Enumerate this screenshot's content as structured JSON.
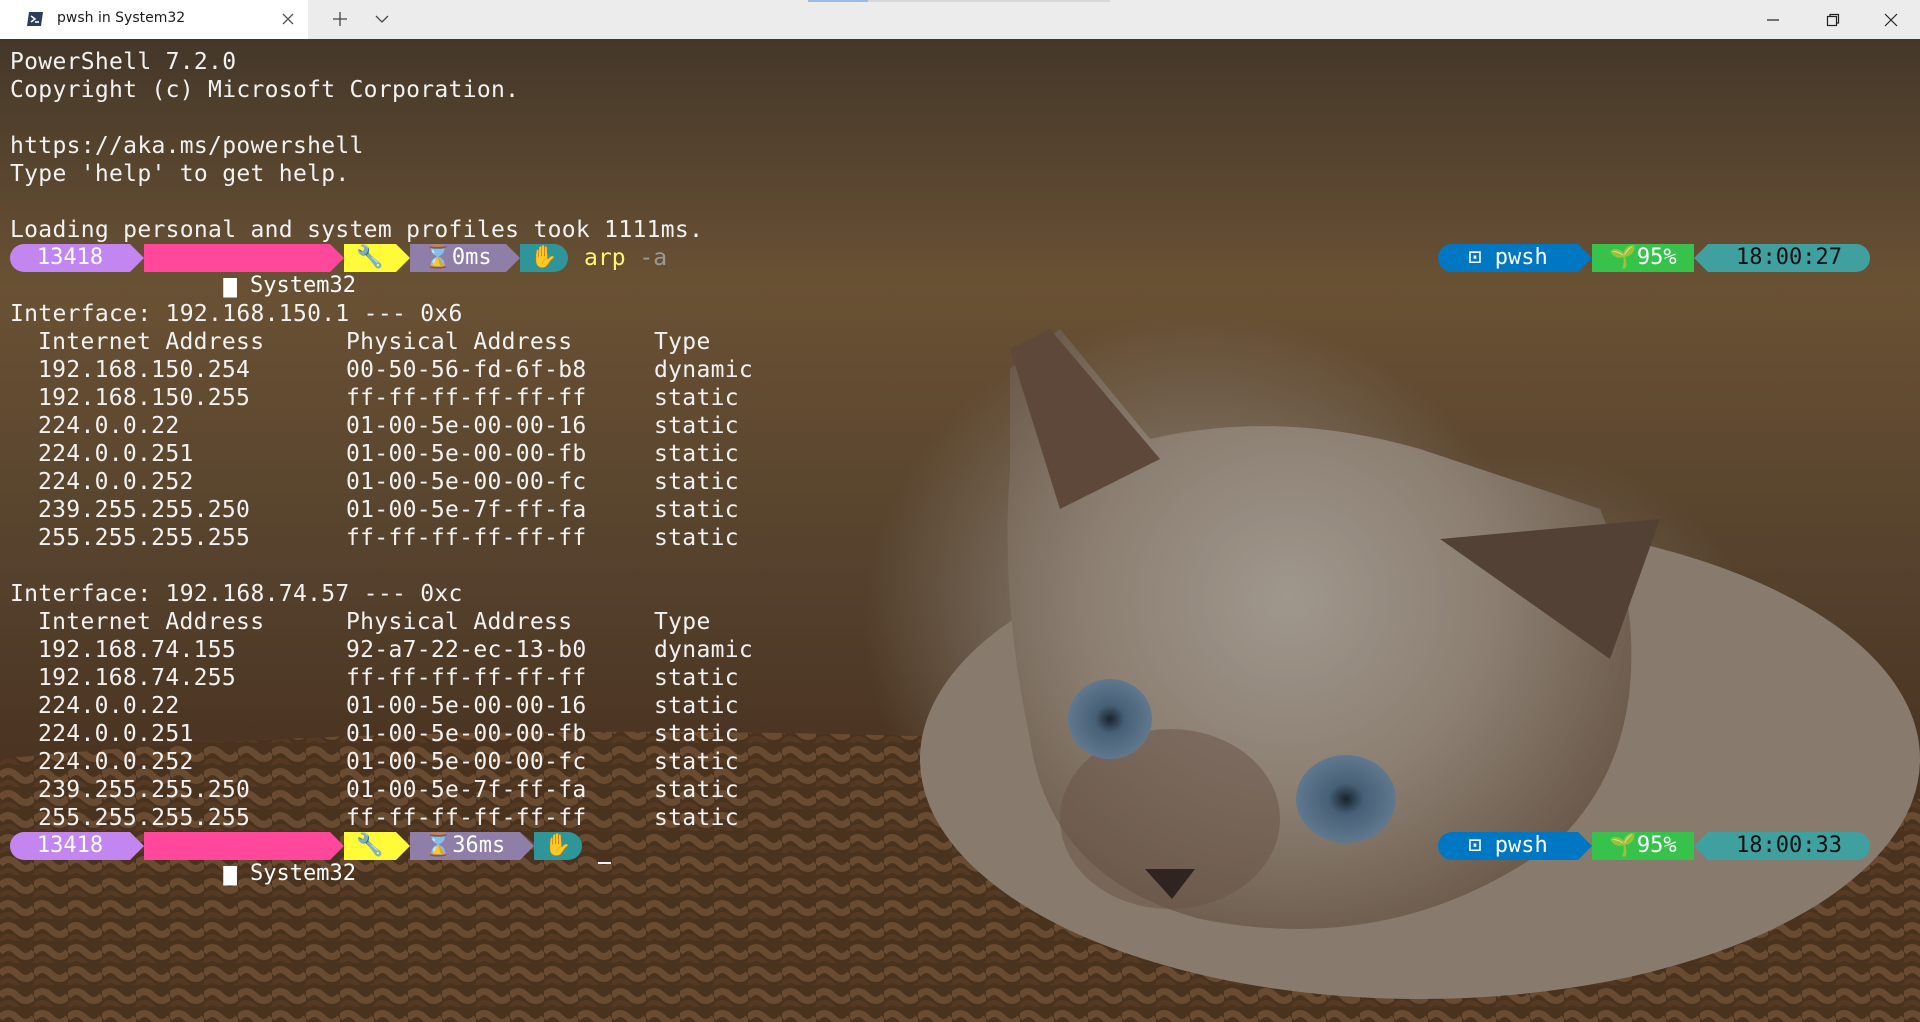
{
  "window": {
    "tab_title": "pwsh in System32",
    "tab_icon": "powershell-icon",
    "new_tab_icon": "plus-icon",
    "dropdown_icon": "chevron-down-icon",
    "controls": [
      "minimize-icon",
      "maximize-icon",
      "close-icon"
    ]
  },
  "banner": {
    "version": "PowerShell 7.2.0",
    "copyright": "Copyright (c) Microsoft Corporation.",
    "url": "https://aka.ms/powershell",
    "help": "Type 'help' to get help.",
    "profiles": "Loading personal and system profiles took 1111ms."
  },
  "prompts": [
    {
      "pid": "13418",
      "folder": "System32",
      "duration": "0ms",
      "command": "arp",
      "args": "-a",
      "shell": "pwsh",
      "battery": "95%",
      "clock": "18:00:27"
    },
    {
      "pid": "13418",
      "folder": "System32",
      "duration": "36ms",
      "command": "",
      "args": "",
      "shell": "pwsh",
      "battery": "95%",
      "clock": "18:00:33"
    }
  ],
  "prompt_icons": {
    "folder": "folder-icon",
    "git": "wrench-icon",
    "timer": "hourglass-icon",
    "status": "hand-icon",
    "shell": "terminal-icon",
    "battery": "sprout-icon"
  },
  "colors": {
    "pid_bg": "#c386f1",
    "path_bg": "#ff479c",
    "git_bg": "#fffb38",
    "time_bg": "#8f7fa8",
    "status_bg": "#2e9599",
    "shell_bg": "#0077c2",
    "battery_bg": "#36c24b",
    "clock_bg": "#40a0a0",
    "command": "#f9f871"
  },
  "arp": {
    "headers": [
      "Internet Address",
      "Physical Address",
      "Type"
    ],
    "interfaces": [
      {
        "title": "Interface: 192.168.150.1 --- 0x6",
        "rows": [
          [
            "192.168.150.254",
            "00-50-56-fd-6f-b8",
            "dynamic"
          ],
          [
            "192.168.150.255",
            "ff-ff-ff-ff-ff-ff",
            "static"
          ],
          [
            "224.0.0.22",
            "01-00-5e-00-00-16",
            "static"
          ],
          [
            "224.0.0.251",
            "01-00-5e-00-00-fb",
            "static"
          ],
          [
            "224.0.0.252",
            "01-00-5e-00-00-fc",
            "static"
          ],
          [
            "239.255.255.250",
            "01-00-5e-7f-ff-fa",
            "static"
          ],
          [
            "255.255.255.255",
            "ff-ff-ff-ff-ff-ff",
            "static"
          ]
        ]
      },
      {
        "title": "Interface: 192.168.74.57 --- 0xc",
        "rows": [
          [
            "192.168.74.155",
            "92-a7-22-ec-13-b0",
            "dynamic"
          ],
          [
            "192.168.74.255",
            "ff-ff-ff-ff-ff-ff",
            "static"
          ],
          [
            "224.0.0.22",
            "01-00-5e-00-00-16",
            "static"
          ],
          [
            "224.0.0.251",
            "01-00-5e-00-00-fb",
            "static"
          ],
          [
            "224.0.0.252",
            "01-00-5e-00-00-fc",
            "static"
          ],
          [
            "239.255.255.250",
            "01-00-5e-7f-ff-fa",
            "static"
          ],
          [
            "255.255.255.255",
            "ff-ff-ff-ff-ff-ff",
            "static"
          ]
        ]
      }
    ]
  }
}
